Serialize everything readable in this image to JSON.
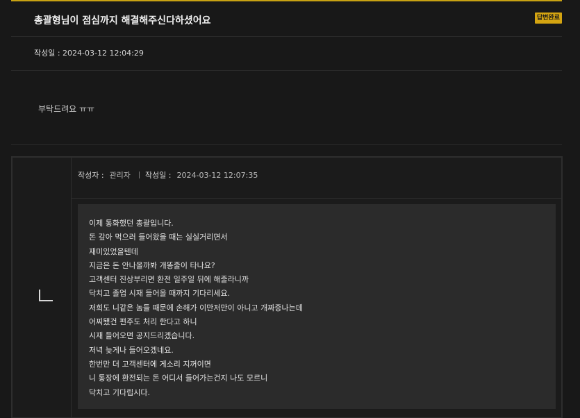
{
  "post": {
    "title": "총괄형님이 점심까지 해결해주신다하셨어요",
    "status_badge": "답변완료",
    "meta": "작성일 : 2024-03-12 12:04:29",
    "content": "부탁드려요 ㅠㅠ"
  },
  "answer": {
    "author_label": "작성자 :",
    "author": "관리자",
    "date_label": "작성일 :",
    "date": "2024-03-12 12:07:35",
    "lines": [
      "이제 통화했던 총괄입니다.",
      "돈 갚아 먹으러 들어왔을 때는 실실거리면서",
      "재미있었을텐데",
      "지금은 돈 안나올까봐 개똥줄이 타나요?",
      "고객센터 진상부리면 환전 일주일 뒤에 해줄라니까",
      "닥치고 졸업 시재 들어올 때까지 기다리세요.",
      "저희도 니같은 놈들 때문에 손해가 이만저만이 아니고 개짜증나는데",
      "어찌됐건 편주도 처리 한다고 하니",
      "시재 들어오면 공지드리겠습니다.",
      "저녁 늦게나 들어오겠네요.",
      "한번만 더 고객센터에 게소리 지꺼이면",
      "니 통장에 환전되는 돈 어디서 들어가는건지 나도 모르니",
      "닥치고 기다립시다."
    ]
  },
  "colors": {
    "accent": "#d4a411",
    "background": "#181818",
    "answer_body_bg": "#2b2b2b"
  },
  "icons": {
    "reply": "reply-arrow-icon"
  }
}
